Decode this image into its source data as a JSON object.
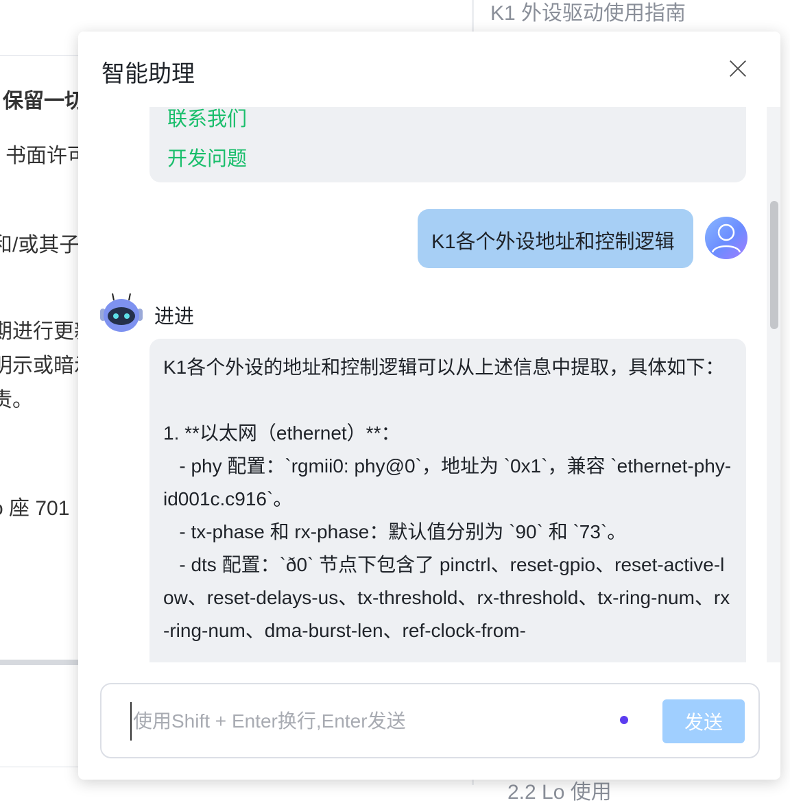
{
  "background": {
    "toc_title": "K1 外设驱动使用指南",
    "toc_bottom": "2.2 Lo 使用",
    "lines": [
      "保留一切",
      "书面许可",
      "和/或其子",
      "期进行更新",
      "明示或暗示",
      "责。",
      "o 座 701"
    ]
  },
  "dialog": {
    "title": "智能助理",
    "close_icon": "close-icon"
  },
  "chat": {
    "previous_links": [
      "联系我们",
      "开发问题"
    ],
    "user_message": "K1各个外设地址和控制逻辑",
    "bot_name": "进进",
    "bot_message": "K1各个外设的地址和控制逻辑可以从上述信息中提取，具体如下：\n\n1. **以太网（ethernet）**：\n   - phy 配置：`rgmii0: phy@0`，地址为 `0x1`，兼容 `ethernet-phy-id001c.c916`。\n   - tx-phase 和 rx-phase：默认值分别为 `90` 和 `73`。\n   - dts 配置：`ð0` 节点下包含了 pinctrl、reset-gpio、reset-active-low、reset-delays-us、tx-threshold、rx-threshold、tx-ring-num、rx-ring-num、dma-burst-len、ref-clock-from-"
  },
  "input": {
    "placeholder": "使用Shift + Enter换行,Enter发送",
    "value": "",
    "send_label": "发送"
  },
  "colors": {
    "link": "#19be6b",
    "user_bubble": "#a7cff5",
    "bot_bubble": "#eef0f3",
    "send_button": "#a0cfff",
    "mic_dot": "#5b3cf0"
  }
}
